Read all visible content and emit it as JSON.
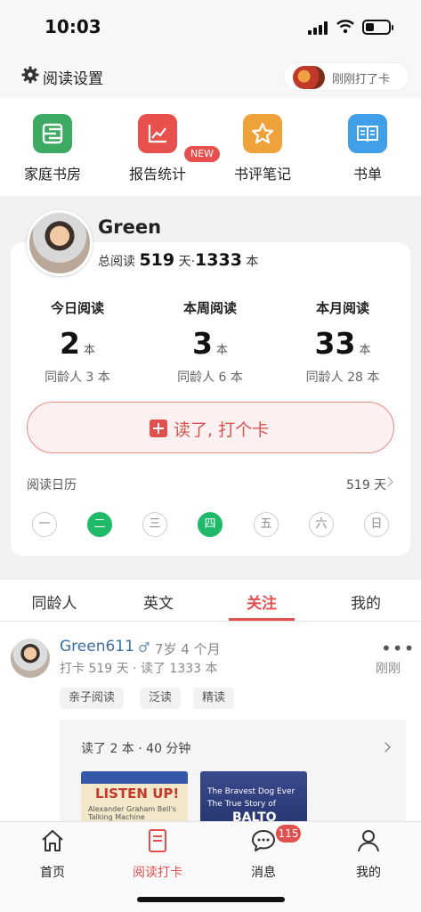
{
  "status_bar": {
    "time": "10:03"
  },
  "header": {
    "settings_label": "阅读设置",
    "checkin_pill_text": "刚刚打了卡"
  },
  "shortcuts": [
    {
      "label": "家庭书房",
      "color": "#3daa63",
      "icon": "bookshelf-icon"
    },
    {
      "label": "报告统计",
      "color": "#e8504e",
      "icon": "line-chart-icon"
    },
    {
      "label": "书评笔记",
      "color": "#f0a23a",
      "icon": "star-icon"
    },
    {
      "label": "书单",
      "color": "#3f9fe8",
      "icon": "open-book-icon"
    }
  ],
  "new_badge": "NEW",
  "profile": {
    "name": "Green",
    "totals_prefix": "总阅读",
    "total_days": "519",
    "days_unit": "天",
    "sep": "·",
    "total_books": "1333",
    "books_unit": "本"
  },
  "stats": [
    {
      "title": "今日阅读",
      "value": "2",
      "unit": "本",
      "peer": "同龄人 3 本"
    },
    {
      "title": "本周阅读",
      "value": "3",
      "unit": "本",
      "peer": "同龄人 6 本"
    },
    {
      "title": "本月阅读",
      "value": "33",
      "unit": "本",
      "peer": "同龄人 28 本"
    }
  ],
  "checkin_button": "读了, 打个卡",
  "calendar": {
    "label": "阅读日历",
    "total": "519 天",
    "days": [
      {
        "label": "一",
        "done": false
      },
      {
        "label": "二",
        "done": true
      },
      {
        "label": "三",
        "done": false
      },
      {
        "label": "四",
        "done": true
      },
      {
        "label": "五",
        "done": false
      },
      {
        "label": "六",
        "done": false
      },
      {
        "label": "日",
        "done": false
      }
    ]
  },
  "tabs": [
    {
      "label": "同龄人"
    },
    {
      "label": "英文"
    },
    {
      "label": "关注",
      "active": true
    },
    {
      "label": "我的"
    }
  ],
  "feed": {
    "name": "Green611",
    "gender_symbol": "♂",
    "age": "7岁 4 个月",
    "meta": "打卡 519 天 · 读了 1333 本",
    "more": "•••",
    "time": "刚刚",
    "tags": [
      "亲子阅读",
      "泛读",
      "精读"
    ],
    "summary": "读了 2 本 · 40 分钟",
    "books": [
      {
        "title": "LISTEN UP!",
        "subtitle": "Alexander Graham Bell's Talking Machine"
      },
      {
        "title_line1": "The Bravest Dog Ever",
        "title_line2": "The True Story of",
        "title_line3": "BALTO"
      }
    ]
  },
  "nav": [
    {
      "label": "首页",
      "icon": "home-icon"
    },
    {
      "label": "阅读打卡",
      "icon": "checkin-book-icon",
      "active": true
    },
    {
      "label": "消息",
      "icon": "chat-bubble-icon",
      "badge": "115"
    },
    {
      "label": "我的",
      "icon": "person-icon"
    }
  ],
  "colors": {
    "accent": "#e0504e",
    "done_green": "#1fb96a",
    "link_blue": "#3a6ea5"
  }
}
